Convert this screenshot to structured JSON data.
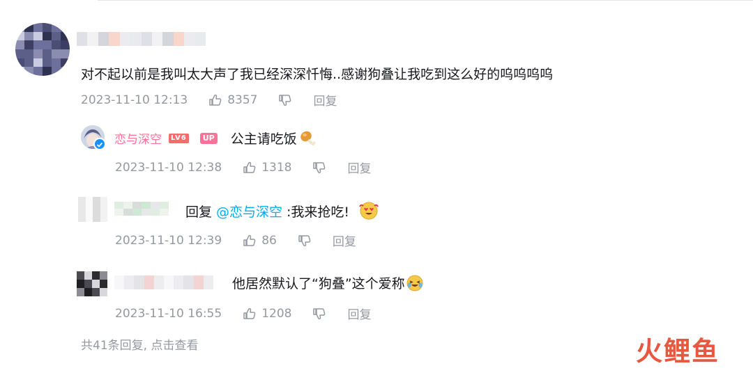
{
  "comment": {
    "text": "对不起以前是我叫太大声了我已经深深忏悔..感谢狗叠让我吃到这么好的呜呜呜呜",
    "time": "2023-11-10 12:13",
    "likes": "8357",
    "reply_label": "回复"
  },
  "replies": [
    {
      "author": "恋与深空",
      "level_badge": "LV6",
      "up_badge": "UP",
      "text": "公主请吃饭",
      "time": "2023-11-10 12:38",
      "likes": "1318",
      "reply_label": "回复"
    },
    {
      "prefix": "回复",
      "mention": "@恋与深空",
      "text": ":我来抢吃!",
      "time": "2023-11-10 12:39",
      "likes": "86",
      "reply_label": "回复"
    },
    {
      "text": "他居然默认了“狗叠”这个爱称",
      "time": "2023-11-10 16:55",
      "likes": "1208",
      "reply_label": "回复"
    }
  ],
  "footer": {
    "text": "共41条回复, 点击查看"
  },
  "watermark": {
    "text": "火鲤鱼"
  },
  "colors": {
    "up_name": "#fb7299",
    "mention": "#00aeec",
    "meta_gray": "#9499a0"
  }
}
